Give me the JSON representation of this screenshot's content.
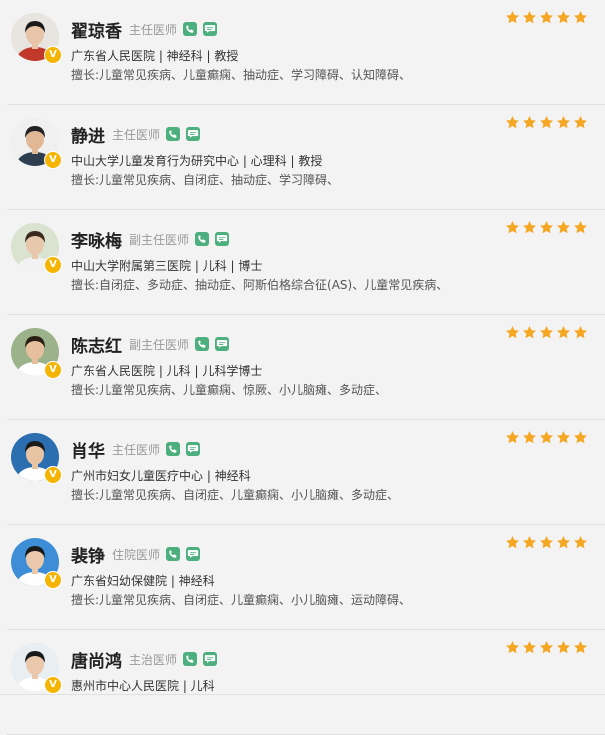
{
  "colors": {
    "star": "#f5a623",
    "badge": "#f5b400",
    "icon": "#4caf7d"
  },
  "doctors": [
    {
      "name": "翟琼香",
      "title": "主任医师",
      "info": "广东省人民医院 | 神经科 | 教授",
      "specialty": "擅长:儿童常见疾病、儿童癫痫、抽动症、学习障碍、认知障碍、",
      "rating": 5
    },
    {
      "name": "静进",
      "title": "主任医师",
      "info": "中山大学儿童发育行为研究中心 | 心理科 | 教授",
      "specialty": "擅长:儿童常见疾病、自闭症、抽动症、学习障碍、",
      "rating": 5
    },
    {
      "name": "李咏梅",
      "title": "副主任医师",
      "info": "中山大学附属第三医院 | 儿科 | 博士",
      "specialty": "擅长:自闭症、多动症、抽动症、阿斯伯格综合征(AS)、儿童常见疾病、",
      "rating": 5
    },
    {
      "name": "陈志红",
      "title": "副主任医师",
      "info": "广东省人民医院 | 儿科 | 儿科学博士",
      "specialty": "擅长:儿童常见疾病、儿童癫痫、惊厥、小儿脑瘫、多动症、",
      "rating": 5
    },
    {
      "name": "肖华",
      "title": "主任医师",
      "info": "广州市妇女儿童医疗中心 | 神经科",
      "specialty": "擅长:儿童常见疾病、自闭症、儿童癫痫、小儿脑瘫、多动症、",
      "rating": 5
    },
    {
      "name": "裴铮",
      "title": "住院医师",
      "info": "广东省妇幼保健院 | 神经科",
      "specialty": "擅长:儿童常见疾病、自闭症、儿童癫痫、小儿脑瘫、运动障碍、",
      "rating": 5
    },
    {
      "name": "唐尚鸿",
      "title": "主治医师",
      "info": "惠州市中心人民医院 | 儿科",
      "specialty": "",
      "rating": 5
    }
  ],
  "badge_label": "V"
}
